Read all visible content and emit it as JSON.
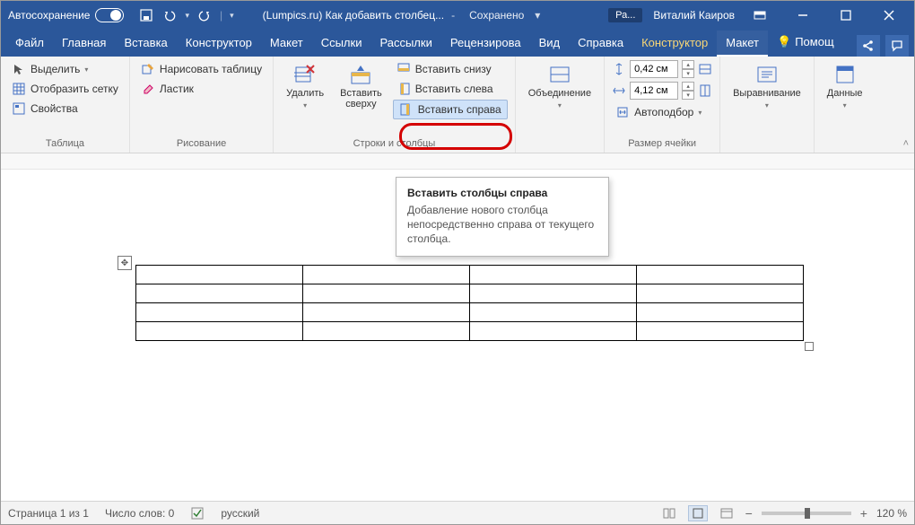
{
  "titlebar": {
    "autosave_label": "Автосохранение",
    "doc_title": "(Lumpics.ru) Как добавить столбец...",
    "save_status": "Сохранено",
    "user_initials": "Ра...",
    "user_name": "Виталий Каиров"
  },
  "tabs": {
    "file": "Файл",
    "home": "Главная",
    "insert": "Вставка",
    "design": "Конструктор",
    "layout": "Макет",
    "references": "Ссылки",
    "mailings": "Рассылки",
    "review": "Рецензирова",
    "view": "Вид",
    "help": "Справка",
    "table_design": "Конструктор",
    "table_layout": "Макет",
    "tell_me": "Помощ"
  },
  "ribbon": {
    "table_group": {
      "select": "Выделить",
      "gridlines": "Отобразить сетку",
      "properties": "Свойства",
      "label": "Таблица"
    },
    "draw_group": {
      "draw": "Нарисовать таблицу",
      "eraser": "Ластик",
      "label": "Рисование"
    },
    "rows_cols_group": {
      "delete": "Удалить",
      "insert_above": "Вставить\nсверху",
      "insert_below": "Вставить снизу",
      "insert_left": "Вставить слева",
      "insert_right": "Вставить справа",
      "label": "Строки и столбцы"
    },
    "merge_group": {
      "merge": "Объединение",
      "label": ""
    },
    "cell_size_group": {
      "height": "0,42 см",
      "width": "4,12 см",
      "autofit": "Автоподбор",
      "label": "Размер ячейки"
    },
    "alignment_group": {
      "alignment": "Выравнивание",
      "label": ""
    },
    "data_group": {
      "data": "Данные",
      "label": ""
    }
  },
  "tooltip": {
    "title": "Вставить столбцы справа",
    "body": "Добавление нового столбца непосредственно справа от текущего столбца."
  },
  "statusbar": {
    "page": "Страница 1 из 1",
    "words": "Число слов: 0",
    "lang": "русский",
    "zoom": "120 %"
  }
}
